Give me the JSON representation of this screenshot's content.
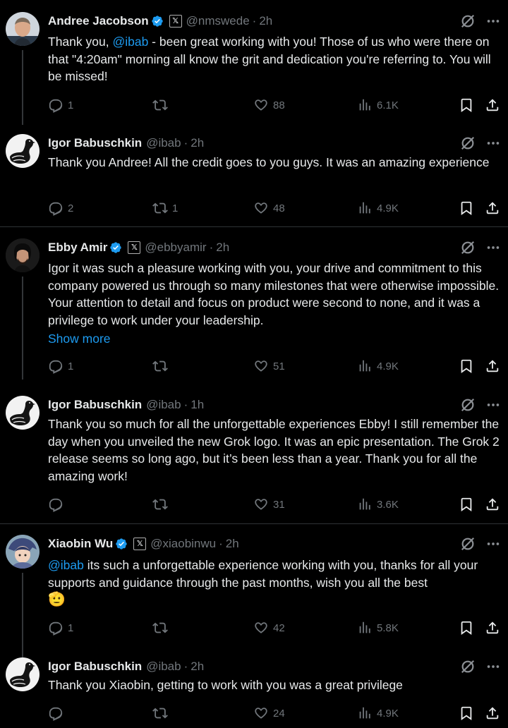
{
  "colors": {
    "background": "#000000",
    "text": "#e7e9ea",
    "muted": "#71767b",
    "link": "#1d9bf0",
    "verified": "#1d9bf0"
  },
  "tweets": [
    {
      "name": "Andree Jacobson",
      "verified": true,
      "affiliate_icon": "x-logo-icon",
      "handle": "@nmswede",
      "time": "2h",
      "mention": "@ibab",
      "text_pre": "Thank you, ",
      "text_post": " - been great working with you! Those of us who were there on that \"4:20am\" morning all know the grit and dedication you're referring to. You will be missed!",
      "replies": "1",
      "retweets": "",
      "likes": "88",
      "views": "6.1K"
    },
    {
      "name": "Igor Babuschkin",
      "verified": false,
      "handle": "@ibab",
      "time": "2h",
      "text": "Thank you Andree! All the credit goes to you guys. It was an amazing experience",
      "replies": "2",
      "retweets": "1",
      "likes": "48",
      "views": "4.9K"
    },
    {
      "name": "Ebby Amir",
      "verified": true,
      "affiliate_icon": "x-logo-icon",
      "handle": "@ebbyamir",
      "time": "2h",
      "text": "Igor it was such a pleasure working with you, your drive and commitment to this company powered us through so many milestones that were otherwise impossible. Your attention to detail and focus on product were second to none, and it was a privilege to work under your leadership.",
      "show_more": "Show more",
      "replies": "1",
      "retweets": "",
      "likes": "51",
      "views": "4.9K"
    },
    {
      "name": "Igor Babuschkin",
      "verified": false,
      "handle": "@ibab",
      "time": "1h",
      "text": "Thank you so much for all the unforgettable experiences Ebby! I still remember the day when you unveiled the new Grok logo. It was an epic presentation. The Grok 2 release seems so long ago, but it’s been less than a year. Thank you for all the amazing work!",
      "replies": "",
      "retweets": "",
      "likes": "31",
      "views": "3.6K"
    },
    {
      "name": "Xiaobin Wu",
      "verified": true,
      "affiliate_icon": "x-logo-icon",
      "handle": "@xiaobinwu",
      "time": "2h",
      "mention": "@ibab",
      "text_post": " its such a unforgettable experience working with you, thanks for all your supports and guidance through the past months, wish you all the best",
      "emoji": "🫡",
      "replies": "1",
      "retweets": "",
      "likes": "42",
      "views": "5.8K"
    },
    {
      "name": "Igor Babuschkin",
      "verified": false,
      "handle": "@ibab",
      "time": "2h",
      "text": "Thank you Xiaobin, getting to work with you was a great privilege",
      "replies": "",
      "retweets": "",
      "likes": "24",
      "views": "4.9K"
    }
  ]
}
